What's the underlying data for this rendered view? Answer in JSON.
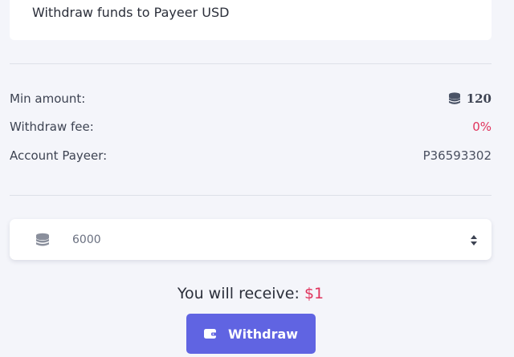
{
  "header": {
    "title": "Withdraw funds to Payeer USD"
  },
  "details": {
    "min_amount_label": "Min amount:",
    "min_amount_value": "120",
    "fee_label": "Withdraw fee:",
    "fee_value": "0%",
    "account_label": "Account Payeer:",
    "account_value": "P36593302"
  },
  "amount_input": {
    "value": "6000",
    "icon": "coins-icon"
  },
  "receive": {
    "label": "You will receive:",
    "amount": "$1"
  },
  "withdraw_button": {
    "label": "Withdraw",
    "icon": "wallet-icon"
  },
  "colors": {
    "accent": "#6064e2",
    "highlight": "#e0335c",
    "background": "#f4f5fa"
  }
}
